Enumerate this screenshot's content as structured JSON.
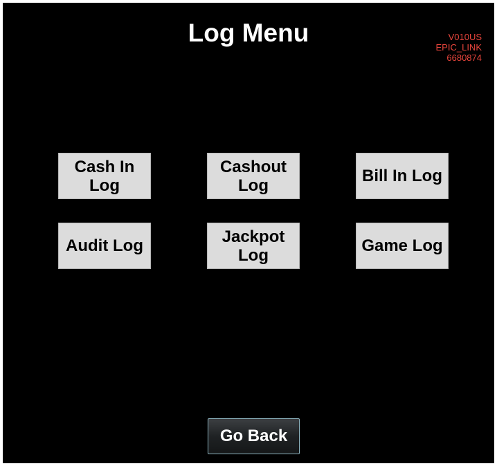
{
  "header": {
    "title": "Log Menu",
    "version_info": [
      "V010US",
      "EPIC_LINK",
      "6680874"
    ]
  },
  "menu": {
    "buttons": [
      {
        "label": "Cash In Log"
      },
      {
        "label": "Cashout Log"
      },
      {
        "label": "Bill In Log"
      },
      {
        "label": "Audit Log"
      },
      {
        "label": "Jackpot Log"
      },
      {
        "label": "Game Log"
      }
    ]
  },
  "footer": {
    "go_back_label": "Go Back"
  },
  "colors": {
    "background": "#000000",
    "button_face": "#dcdcdc",
    "version_text": "#e8453c",
    "go_back_border": "#8fb6c2"
  }
}
